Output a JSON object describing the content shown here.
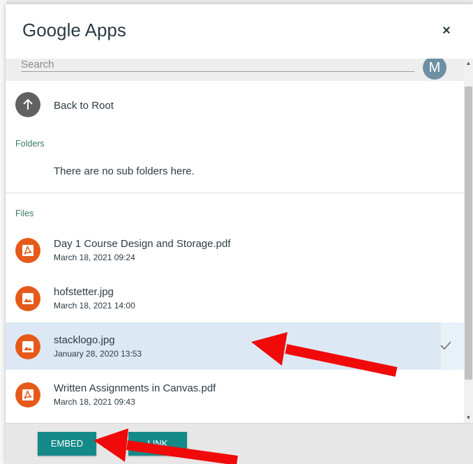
{
  "dialog": {
    "title": "Google Apps",
    "close_label": "×"
  },
  "search": {
    "placeholder": "Search",
    "value": ""
  },
  "user": {
    "avatar_initial": "M"
  },
  "navigation": {
    "back_label": "Back to Root"
  },
  "folders": {
    "label": "Folders",
    "empty_message": "There are no sub folders here."
  },
  "files": {
    "label": "Files",
    "items": [
      {
        "name": "Day 1 Course Design and Storage.pdf",
        "date": "March 18, 2021 09:24",
        "type": "pdf",
        "selected": false
      },
      {
        "name": "hofstetter.jpg",
        "date": "March 18, 2021 14:00",
        "type": "image",
        "selected": false
      },
      {
        "name": "stacklogo.jpg",
        "date": "January 28, 2020 13:53",
        "type": "image",
        "selected": true
      },
      {
        "name": "Written Assignments in Canvas.pdf",
        "date": "March 18, 2021 09:43",
        "type": "pdf",
        "selected": false
      }
    ]
  },
  "footer": {
    "embed_label": "EMBED",
    "link_label": "LINK"
  },
  "colors": {
    "accent": "#138a88",
    "file_icon": "#e55a1a",
    "selected_row": "#dce9f4",
    "annotation_arrow": "#f00a0a"
  },
  "icons": {
    "back": "arrow-up-icon",
    "pdf": "pdf-icon",
    "image": "image-icon",
    "check": "check-icon",
    "close": "close-icon"
  }
}
